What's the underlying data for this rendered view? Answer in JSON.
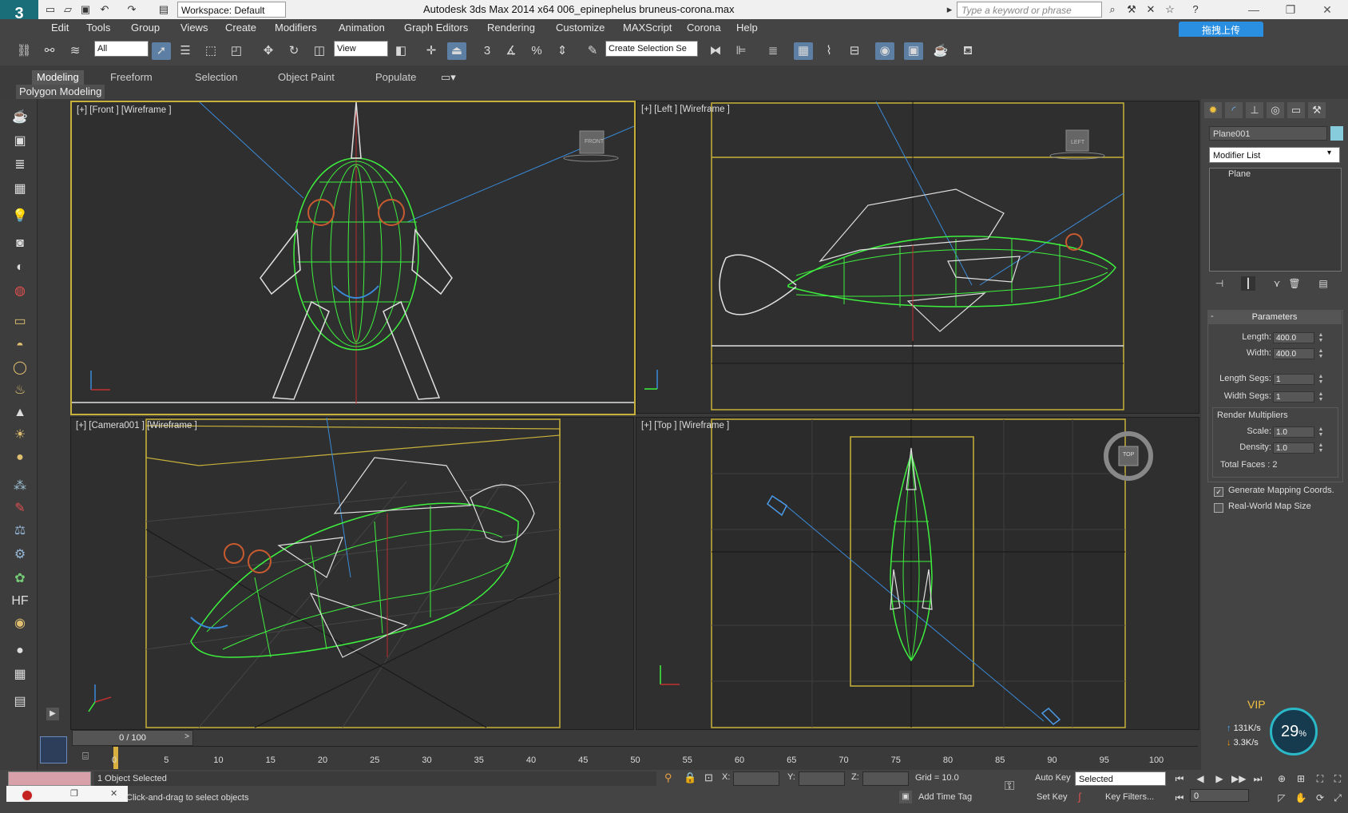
{
  "titlebar": {
    "title": "Autodesk 3ds Max  2014 x64     006_epinephelus bruneus-corona.max",
    "workspace_value": "Workspace: Default",
    "search_placeholder": "Type a keyword or phrase"
  },
  "menu": [
    "Edit",
    "Tools",
    "Group",
    "Views",
    "Create",
    "Modifiers",
    "Animation",
    "Graph Editors",
    "Rendering",
    "Customize",
    "MAXScript",
    "Corona",
    "Help"
  ],
  "upload_button": "拖拽上传",
  "toolbar": {
    "selection_filter": "All",
    "reference_coord": "View",
    "named_selection": "Create Selection Se",
    "snap_label": "3"
  },
  "ribbon": {
    "tabs": [
      "Modeling",
      "Freeform",
      "Selection",
      "Object Paint",
      "Populate"
    ],
    "active_panel": "Polygon Modeling"
  },
  "viewports": {
    "front": {
      "label": "[+] [Front ] [Wireframe ]",
      "cube": "FRONT"
    },
    "left": {
      "label": "[+] [Left ] [Wireframe ]",
      "cube": "LEFT"
    },
    "camera": {
      "label": "[+] [Camera001 ] [Wireframe ]"
    },
    "top": {
      "label": "[+] [Top ] [Wireframe ]",
      "cube": "TOP"
    }
  },
  "command_panel": {
    "object_name": "Plane001",
    "object_color": "#86ccdd",
    "modifier_list": "Modifier List",
    "stack_items": [
      "Plane"
    ],
    "params_title": "Parameters",
    "params": [
      {
        "label": "Length:",
        "value": "400.0"
      },
      {
        "label": "Width:",
        "value": "400.0"
      },
      {
        "label": "Length Segs:",
        "value": "1"
      },
      {
        "label": "Width Segs:",
        "value": "1"
      }
    ],
    "render_multipliers": {
      "title": "Render Multipliers",
      "scale_label": "Scale:",
      "scale_value": "1.0",
      "density_label": "Density:",
      "density_value": "1.0",
      "total_faces": "Total Faces : 2"
    },
    "checkboxes": [
      {
        "label": "Generate Mapping Coords.",
        "checked": true
      },
      {
        "label": "Real-World Map Size",
        "checked": false
      }
    ]
  },
  "network_widget": {
    "percent": "29",
    "up_rate": "131K/s",
    "down_rate": "3.3K/s",
    "badge": "VIP"
  },
  "time": {
    "slider_text": "0 / 100",
    "ticks": [
      "0",
      "5",
      "10",
      "15",
      "20",
      "25",
      "30",
      "35",
      "40",
      "45",
      "50",
      "55",
      "60",
      "65",
      "70",
      "75",
      "80",
      "85",
      "90",
      "95",
      "100"
    ]
  },
  "status": {
    "selected": "1 Object Selected",
    "prompt": "Click-and-drag to select objects",
    "x_label": "X:",
    "y_label": "Y:",
    "z_label": "Z:",
    "grid": "Grid = 10.0",
    "add_time_tag": "Add Time Tag",
    "auto_key": "Auto Key",
    "set_key": "Set Key",
    "key_mode": "Selected",
    "key_filters": "Key Filters...",
    "frame": "0"
  },
  "colors": {
    "accent": "#c8b13a",
    "wire_green": "#3ef03e",
    "wire_white": "#e0e0e0",
    "active_blue": "#5d7fa3"
  }
}
